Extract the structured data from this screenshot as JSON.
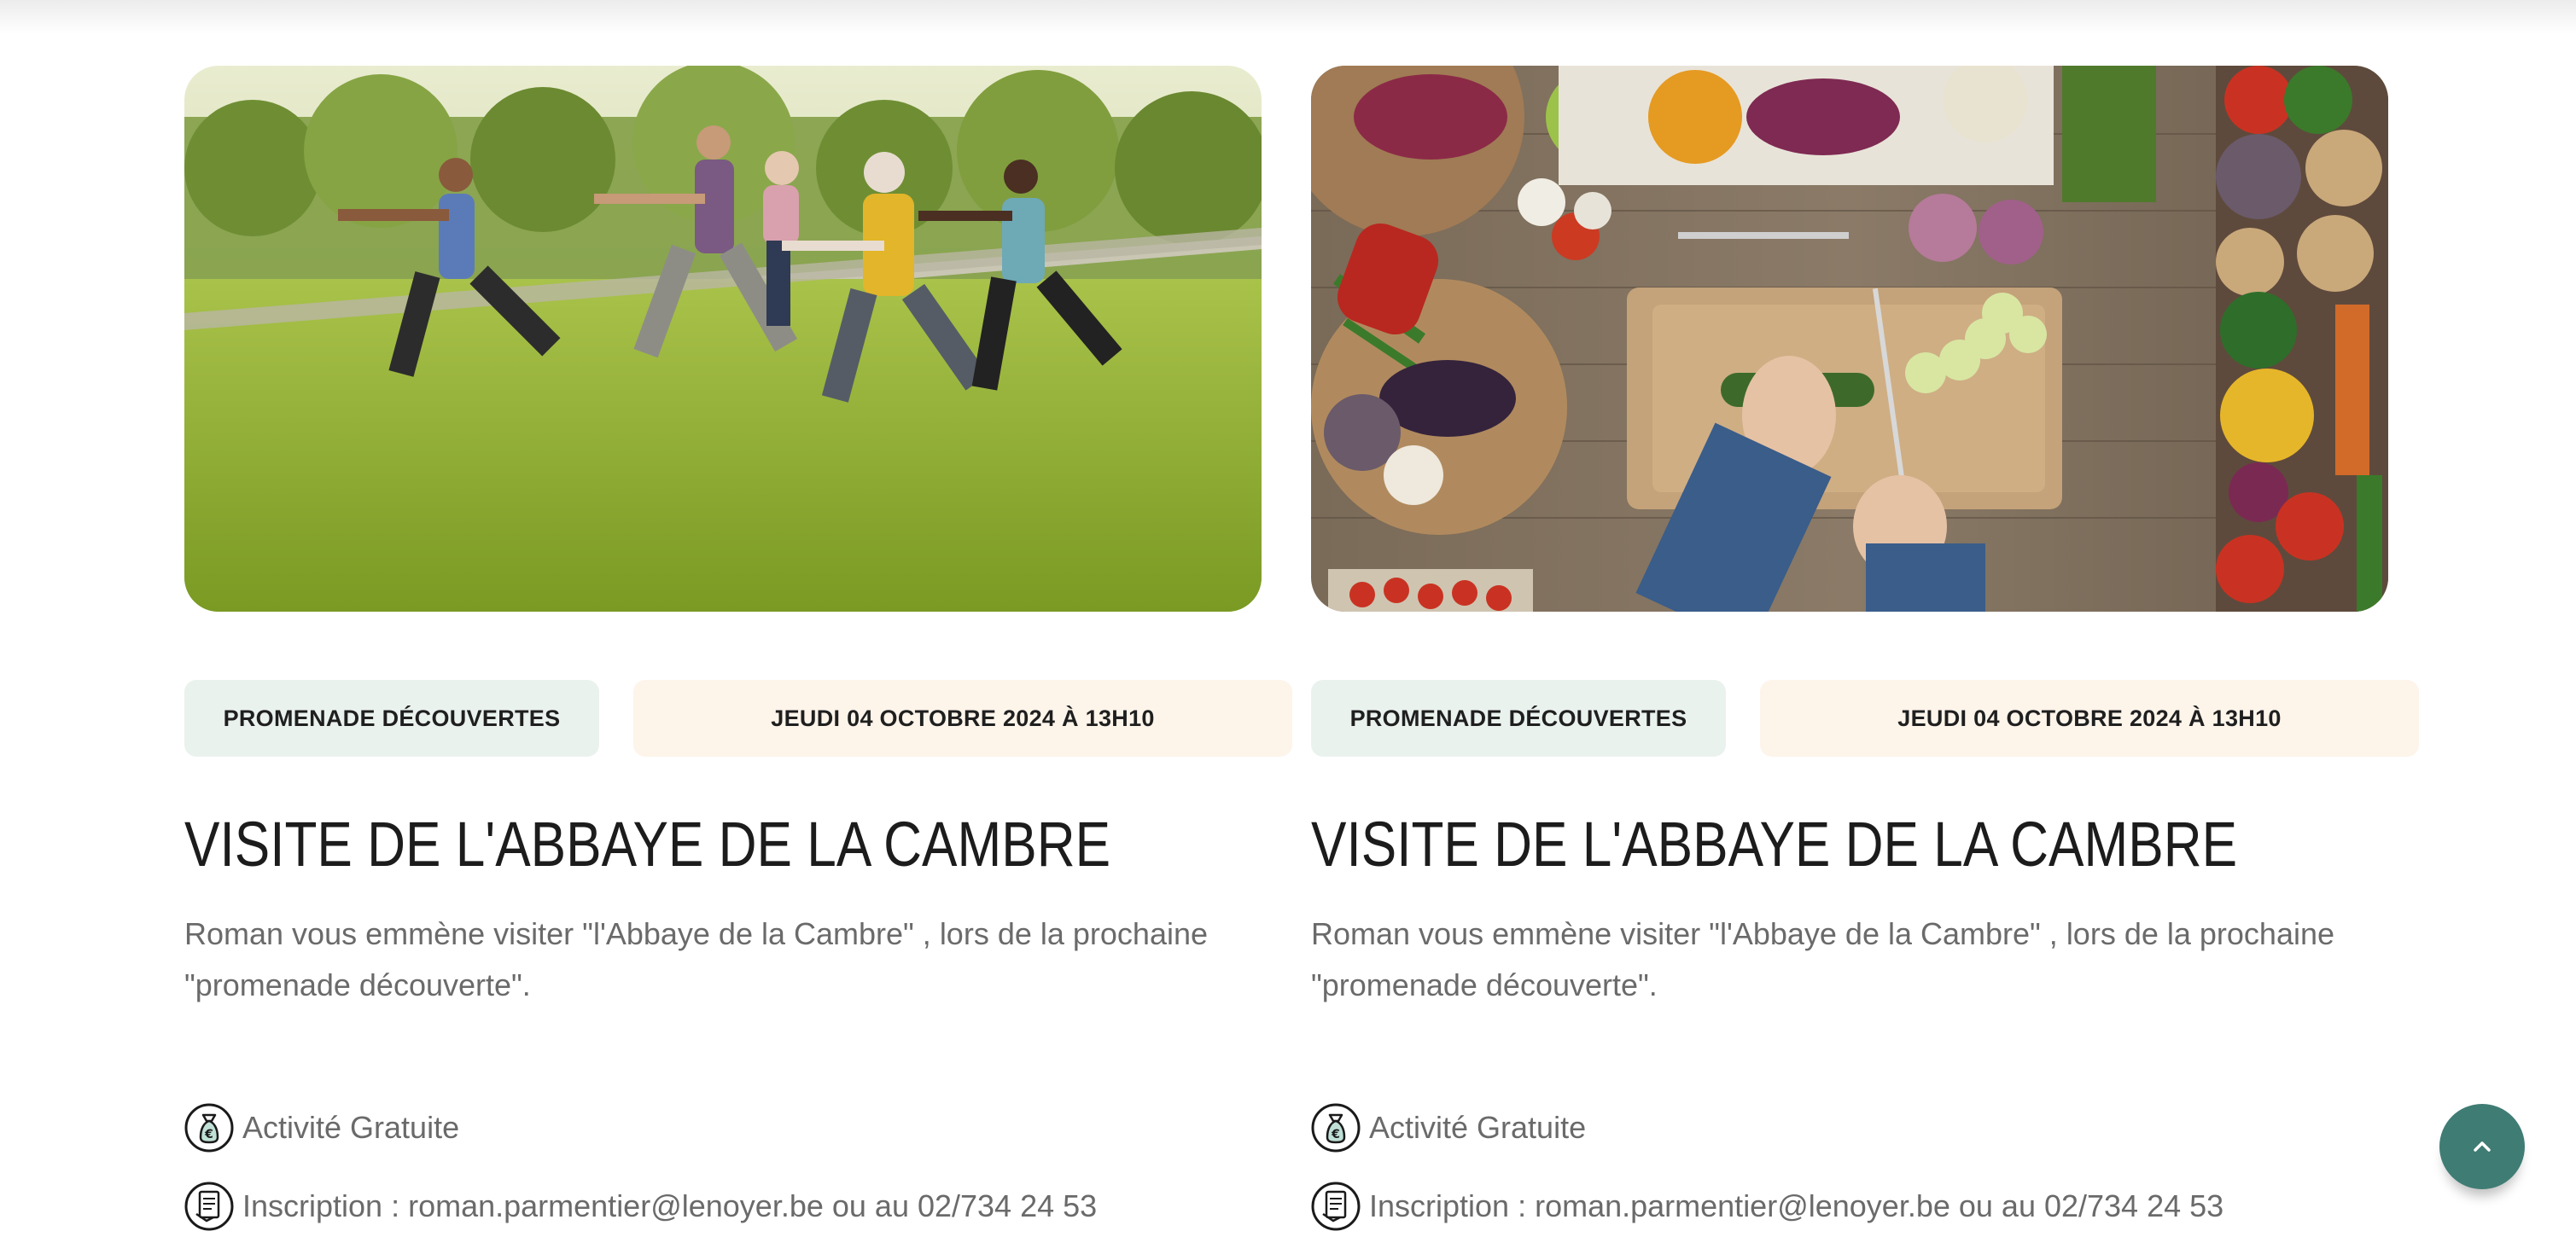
{
  "cards": [
    {
      "image_icon": "tai-chi-group-photo",
      "category": "PROMENADE DÉCOUVERTES",
      "date": "JEUDI 04 OCTOBRE 2024 À 13H10",
      "title": "VISITE DE L'ABBAYE DE LA CAMBRE",
      "description": "Roman vous emmène visiter \"l'Abbaye de la Cambre\" , lors de la prochaine \"promenade découverte\".",
      "price": "Activité Gratuite",
      "contact": "Inscription : roman.parmentier@lenoyer.be ou au 02/734 24 53"
    },
    {
      "image_icon": "vegetables-cutting-board-photo",
      "category": "PROMENADE DÉCOUVERTES",
      "date": "JEUDI 04 OCTOBRE 2024 À 13H10",
      "title": "VISITE DE L'ABBAYE DE LA CAMBRE",
      "description": "Roman vous emmène visiter \"l'Abbaye de la Cambre\" , lors de la prochaine \"promenade découverte\".",
      "price": "Activité Gratuite",
      "contact": "Inscription : roman.parmentier@lenoyer.be ou au 02/734 24 53"
    }
  ],
  "colors": {
    "category_bg": "#eaf2ee",
    "date_bg": "#fdf4ea",
    "accent": "#3f7c74",
    "title": "#1c1c1c",
    "body_text": "#6a6a6a"
  },
  "back_to_top": {
    "icon": "chevron-up-icon"
  }
}
